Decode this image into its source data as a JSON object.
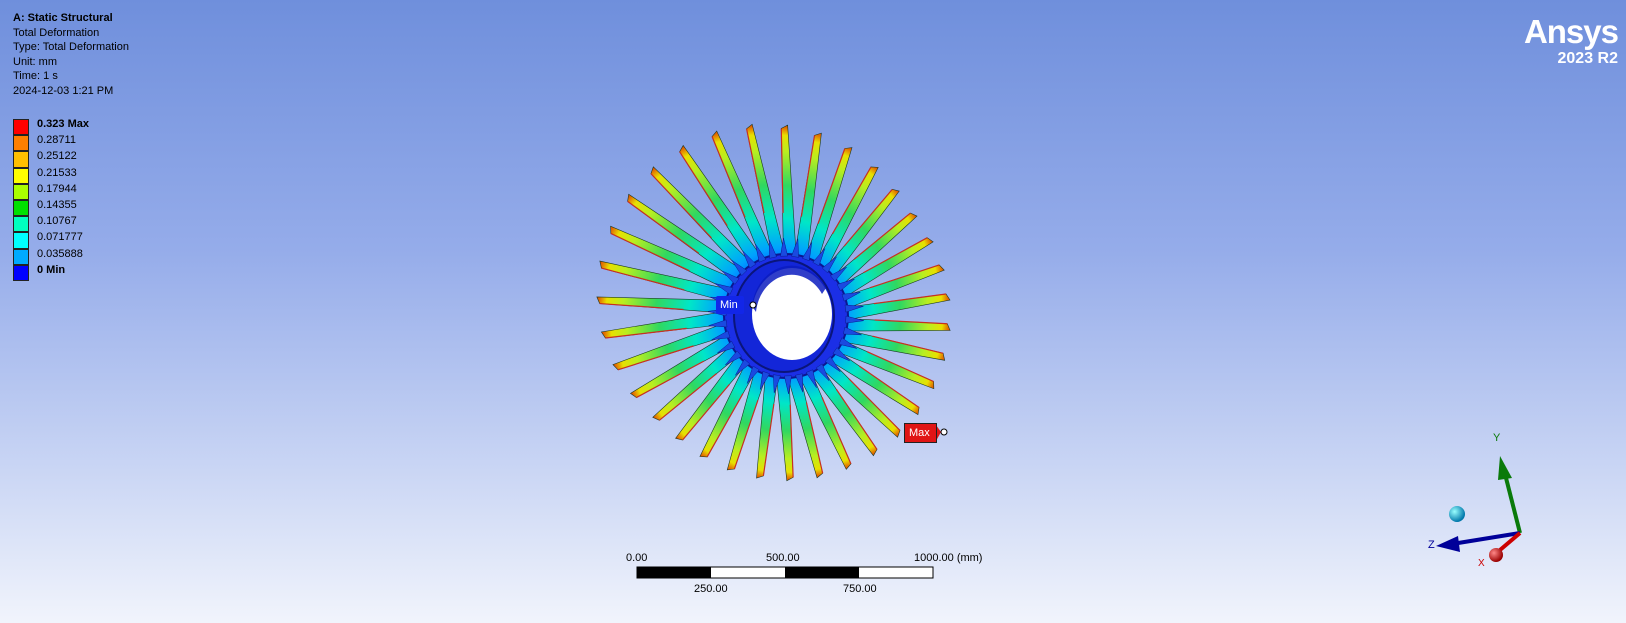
{
  "analysis": {
    "title": "A: Static Structural",
    "result": "Total Deformation",
    "type": "Type: Total Deformation",
    "unit": "Unit: mm",
    "time": "Time: 1 s",
    "timestamp": "2024-12-03 1:21 PM"
  },
  "legend": [
    {
      "label": "0.323 Max",
      "color": "#ff0000",
      "bold": true
    },
    {
      "label": "0.28711",
      "color": "#ff7f00",
      "bold": false
    },
    {
      "label": "0.25122",
      "color": "#ffbf00",
      "bold": false
    },
    {
      "label": "0.21533",
      "color": "#ffff00",
      "bold": false
    },
    {
      "label": "0.17944",
      "color": "#aaff00",
      "bold": false
    },
    {
      "label": "0.14355",
      "color": "#00e000",
      "bold": false
    },
    {
      "label": "0.10767",
      "color": "#00ffbf",
      "bold": false
    },
    {
      "label": "0.071777",
      "color": "#00ffff",
      "bold": false
    },
    {
      "label": "0.035888",
      "color": "#00aaff",
      "bold": false
    },
    {
      "label": "0 Min",
      "color": "#0000ff",
      "bold": true
    }
  ],
  "logo": {
    "brand": "Ansys",
    "version": "2023 R2"
  },
  "probes": {
    "min_label": "Min",
    "max_label": "Max"
  },
  "scale_bar": {
    "top_labels": [
      "0.00",
      "500.00",
      "1000.00 (mm)"
    ],
    "bottom_labels": [
      "250.00",
      "750.00"
    ]
  },
  "triad": {
    "x": "X",
    "y": "Y",
    "z": "Z",
    "x_color": "#cc0000",
    "y_color": "#008000",
    "z_color": "#000099"
  },
  "model": {
    "blade_count": 34
  }
}
